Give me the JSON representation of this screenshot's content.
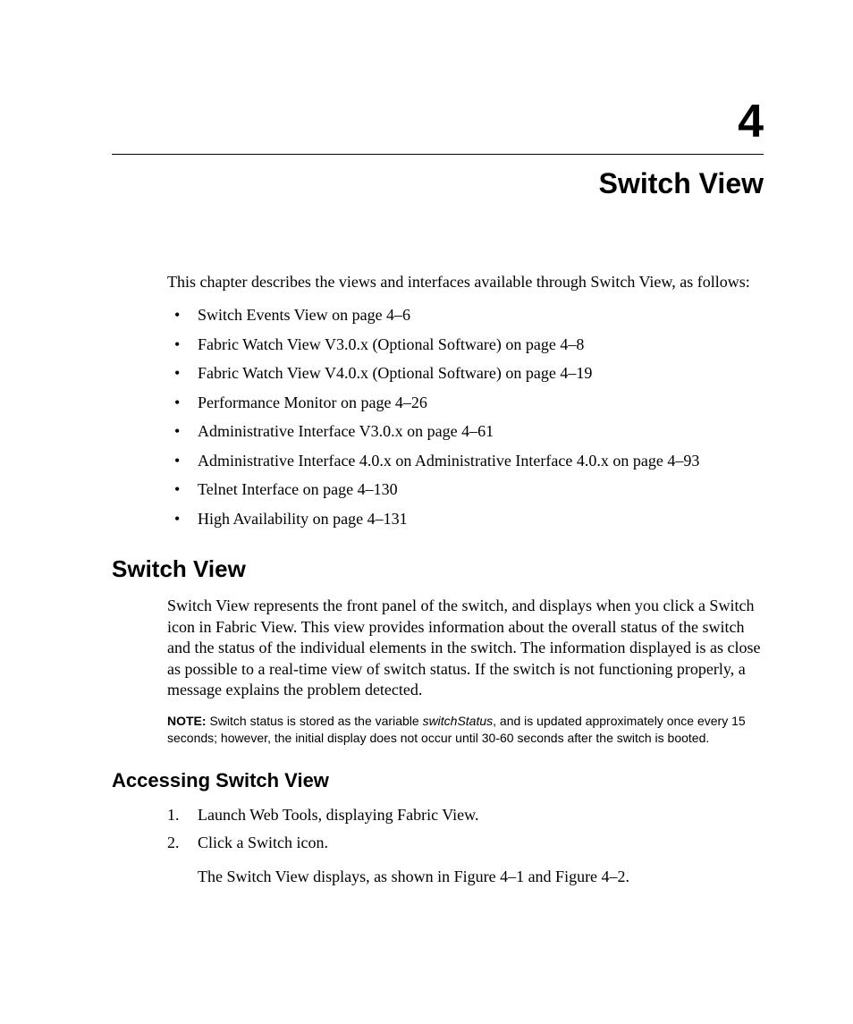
{
  "chapter": {
    "number": "4",
    "title": "Switch View"
  },
  "intro": "This chapter describes the views and interfaces available through Switch View, as follows:",
  "toc": [
    "Switch Events View on page 4–6",
    "Fabric Watch View V3.0.x (Optional Software) on page 4–8",
    "Fabric Watch View V4.0.x (Optional Software) on page 4–19",
    "Performance Monitor on page 4–26",
    "Administrative Interface V3.0.x on page 4–61",
    "Administrative Interface 4.0.x on Administrative Interface 4.0.x on page 4–93",
    "Telnet Interface on page 4–130",
    "High Availability on page 4–131"
  ],
  "section1": {
    "heading": "Switch View",
    "para": "Switch View represents the front panel of the switch, and displays when you click a Switch icon in Fabric View. This view provides information about the overall status of the switch and the status of the individual elements in the switch. The information displayed is as close as possible to a real-time view of switch status. If the switch is not functioning properly, a message explains the problem detected."
  },
  "note": {
    "label": "NOTE:",
    "pre": "  Switch status is stored as the variable ",
    "var": "switchStatus",
    "post": ", and is updated approximately once every 15 seconds; however, the initial display does not occur until 30-60 seconds after the switch is booted."
  },
  "section2": {
    "heading": "Accessing Switch View",
    "steps": [
      {
        "num": "1.",
        "text": "Launch Web Tools, displaying Fabric View."
      },
      {
        "num": "2.",
        "text": "Click a Switch icon.",
        "result": "The Switch View displays, as shown in Figure 4–1 and Figure 4–2."
      }
    ]
  }
}
